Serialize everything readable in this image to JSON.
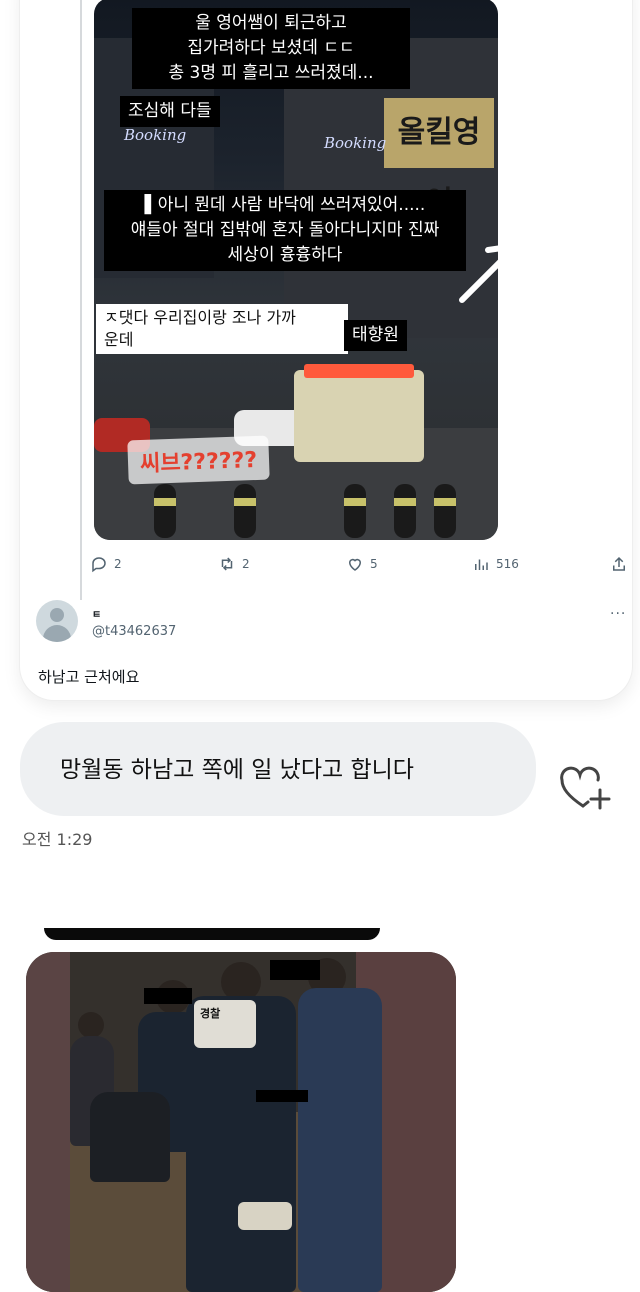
{
  "tweet": {
    "story_captions": {
      "line1": "울 영어쌤이 퇴근하고\n집가려하다 보셨데 ㄷㄷ\n총 3명 피 흘리고 쓰러졌데...",
      "line2": "조심해 다들",
      "line3": "▌아니 뭔데 사람 바닥에 쓰러져있어.....\n얘들아 절대 집밖에 혼자 돌아다니지마 진짜\n세상이 흉흉하다",
      "line4": "ㅈ댓다 우리집이랑 조나 가까\n운데",
      "tag": "태향원",
      "sticker": "씨브??????",
      "sign_english": "올킬영어",
      "neon1": "Booking",
      "neon2": "Booking"
    },
    "actions": {
      "replies": "2",
      "retweets": "2",
      "likes": "5",
      "views": "516"
    },
    "reply": {
      "name": "ㅌ",
      "handle": "@t43462637",
      "text": "하남고 근처에요",
      "more": "···"
    }
  },
  "message": {
    "text": "망월동 하남고 쪽에 일 났다고 합니다",
    "time": "오전 1:29"
  },
  "photo": {
    "vest_label": "경찰"
  },
  "icons": [
    "reply-icon",
    "retweet-icon",
    "like-icon",
    "views-icon",
    "share-icon",
    "heart-plus-icon",
    "avatar"
  ]
}
